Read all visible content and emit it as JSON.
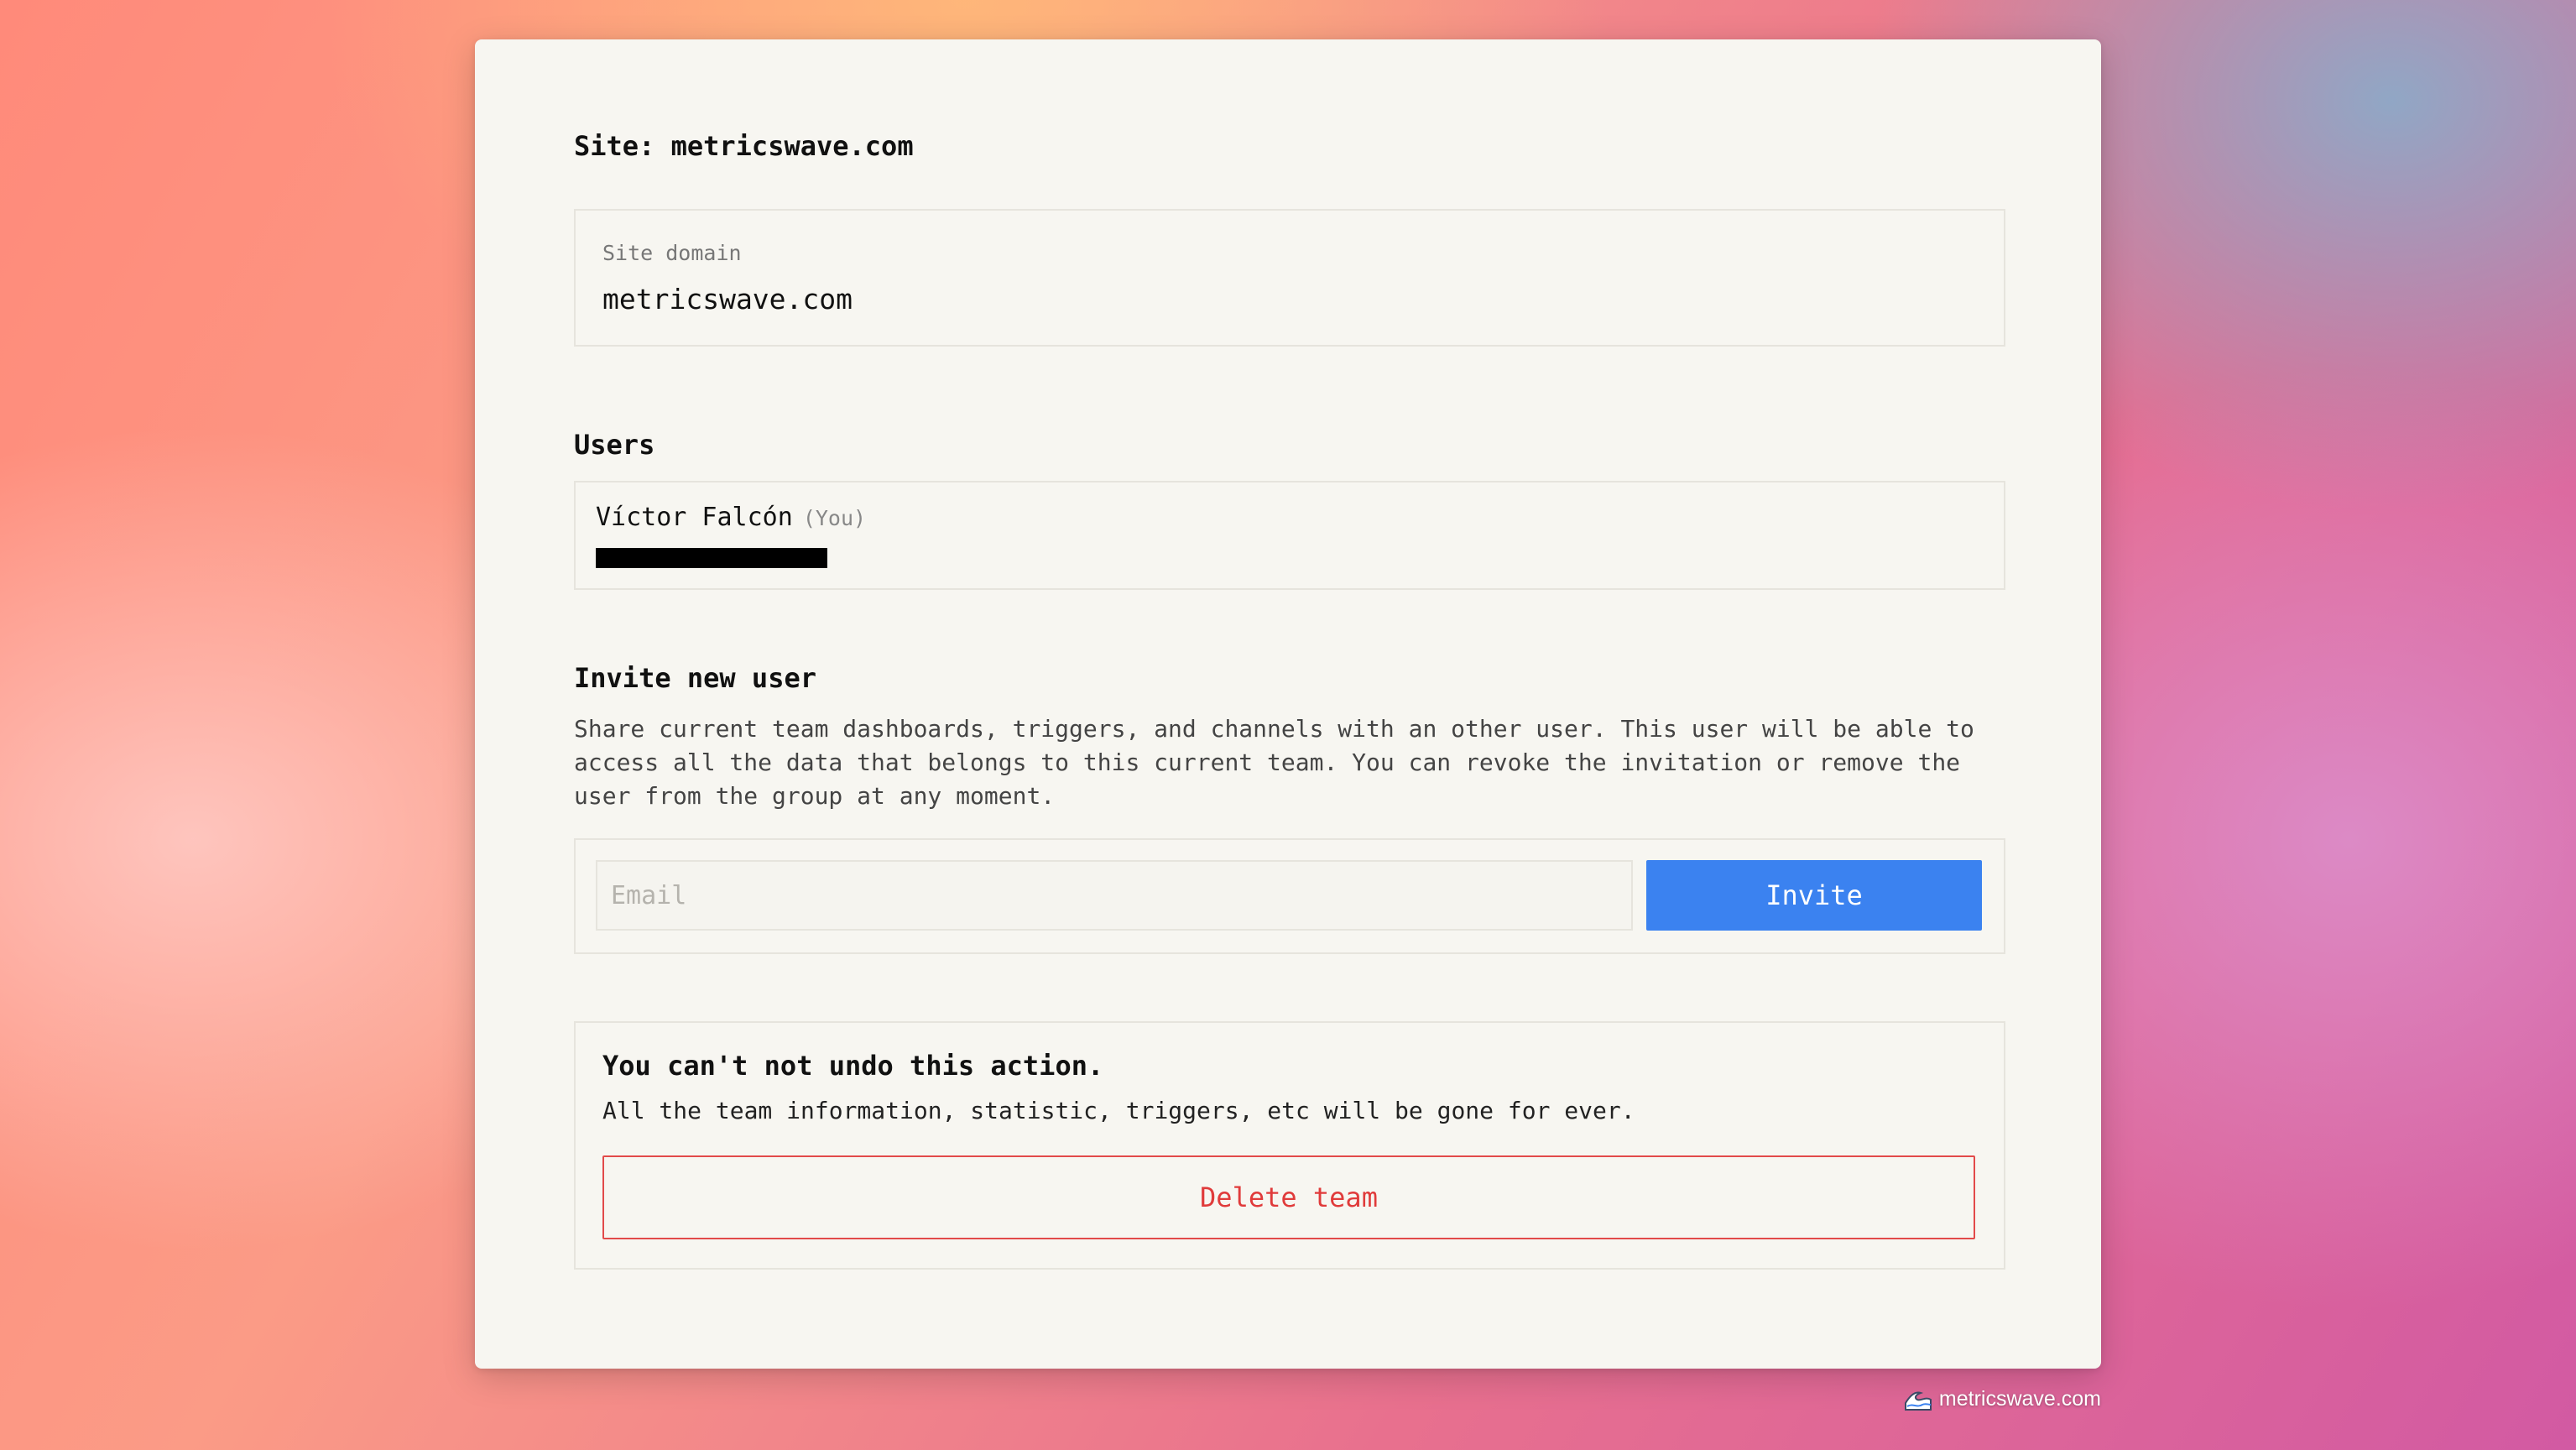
{
  "page": {
    "title": "Site: metricswave.com"
  },
  "site_domain": {
    "label": "Site domain",
    "value": "metricswave.com"
  },
  "users": {
    "heading": "Users",
    "items": [
      {
        "name": "Víctor Falcón",
        "tag": "(You)"
      }
    ]
  },
  "invite": {
    "heading": "Invite new user",
    "description": "Share current team dashboards, triggers, and channels with an other user. This user will be able to access all the data that belongs to this current team. You can revoke the invitation or remove the user from the group at any moment.",
    "email_placeholder": "Email",
    "email_value": "",
    "button_label": "Invite"
  },
  "danger": {
    "title": "You can't not undo this action.",
    "description": "All the team information, statistic, triggers, etc will be gone for ever.",
    "button_label": "Delete team"
  },
  "watermark": {
    "text": "metricswave.com",
    "icon": "wave-icon"
  },
  "colors": {
    "accent": "#3b82f0",
    "danger": "#e03b3b",
    "card_bg": "#f7f6f1"
  }
}
